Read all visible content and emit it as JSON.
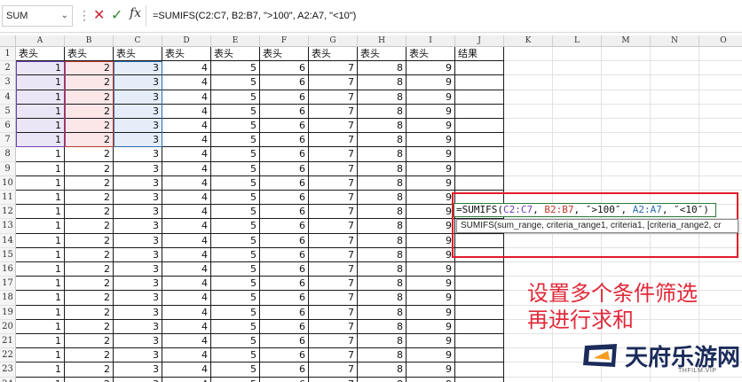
{
  "formula_bar": {
    "name_box": "SUM",
    "fx": "fx",
    "formula": "=SUMIFS(C2:C7, B2:B7, \">100\", A2:A7, \"<10\")"
  },
  "columns": [
    "A",
    "B",
    "C",
    "D",
    "E",
    "F",
    "G",
    "H",
    "I",
    "J",
    "K",
    "L",
    "M",
    "N",
    "O"
  ],
  "rows": [
    "1",
    "2",
    "3",
    "4",
    "5",
    "6",
    "7",
    "8",
    "9",
    "10",
    "11",
    "12",
    "13",
    "14",
    "15",
    "16",
    "17",
    "18",
    "19",
    "20",
    "21",
    "22",
    "23",
    "24"
  ],
  "header_row": [
    "表头",
    "表头",
    "表头",
    "表头",
    "表头",
    "表头",
    "表头",
    "表头",
    "表头",
    "结果"
  ],
  "data_row_values": [
    1,
    2,
    3,
    4,
    5,
    6,
    7,
    8,
    9
  ],
  "editing_cell": {
    "prefix": "=SUMIFS(",
    "ref1": "C2:C7",
    "sep1": ", ",
    "ref2": "B2:B7",
    "mid1": ", ″>100″, ",
    "ref3": "A2:A7",
    "tail": ", ″<10″)"
  },
  "tooltip": "SUMIFS(sum_range, criteria_range1, criteria1, [criteria_range2, cr",
  "caption": [
    "设置多个条件筛选",
    "再进行求和"
  ],
  "watermark": {
    "brand": "天府乐游网",
    "sub": "THFILM.VIP"
  },
  "colors": {
    "accent_red": "#e21b2a",
    "range_a": "#6b3fb5",
    "range_b": "#c0392b",
    "range_c": "#2b6cb0"
  }
}
